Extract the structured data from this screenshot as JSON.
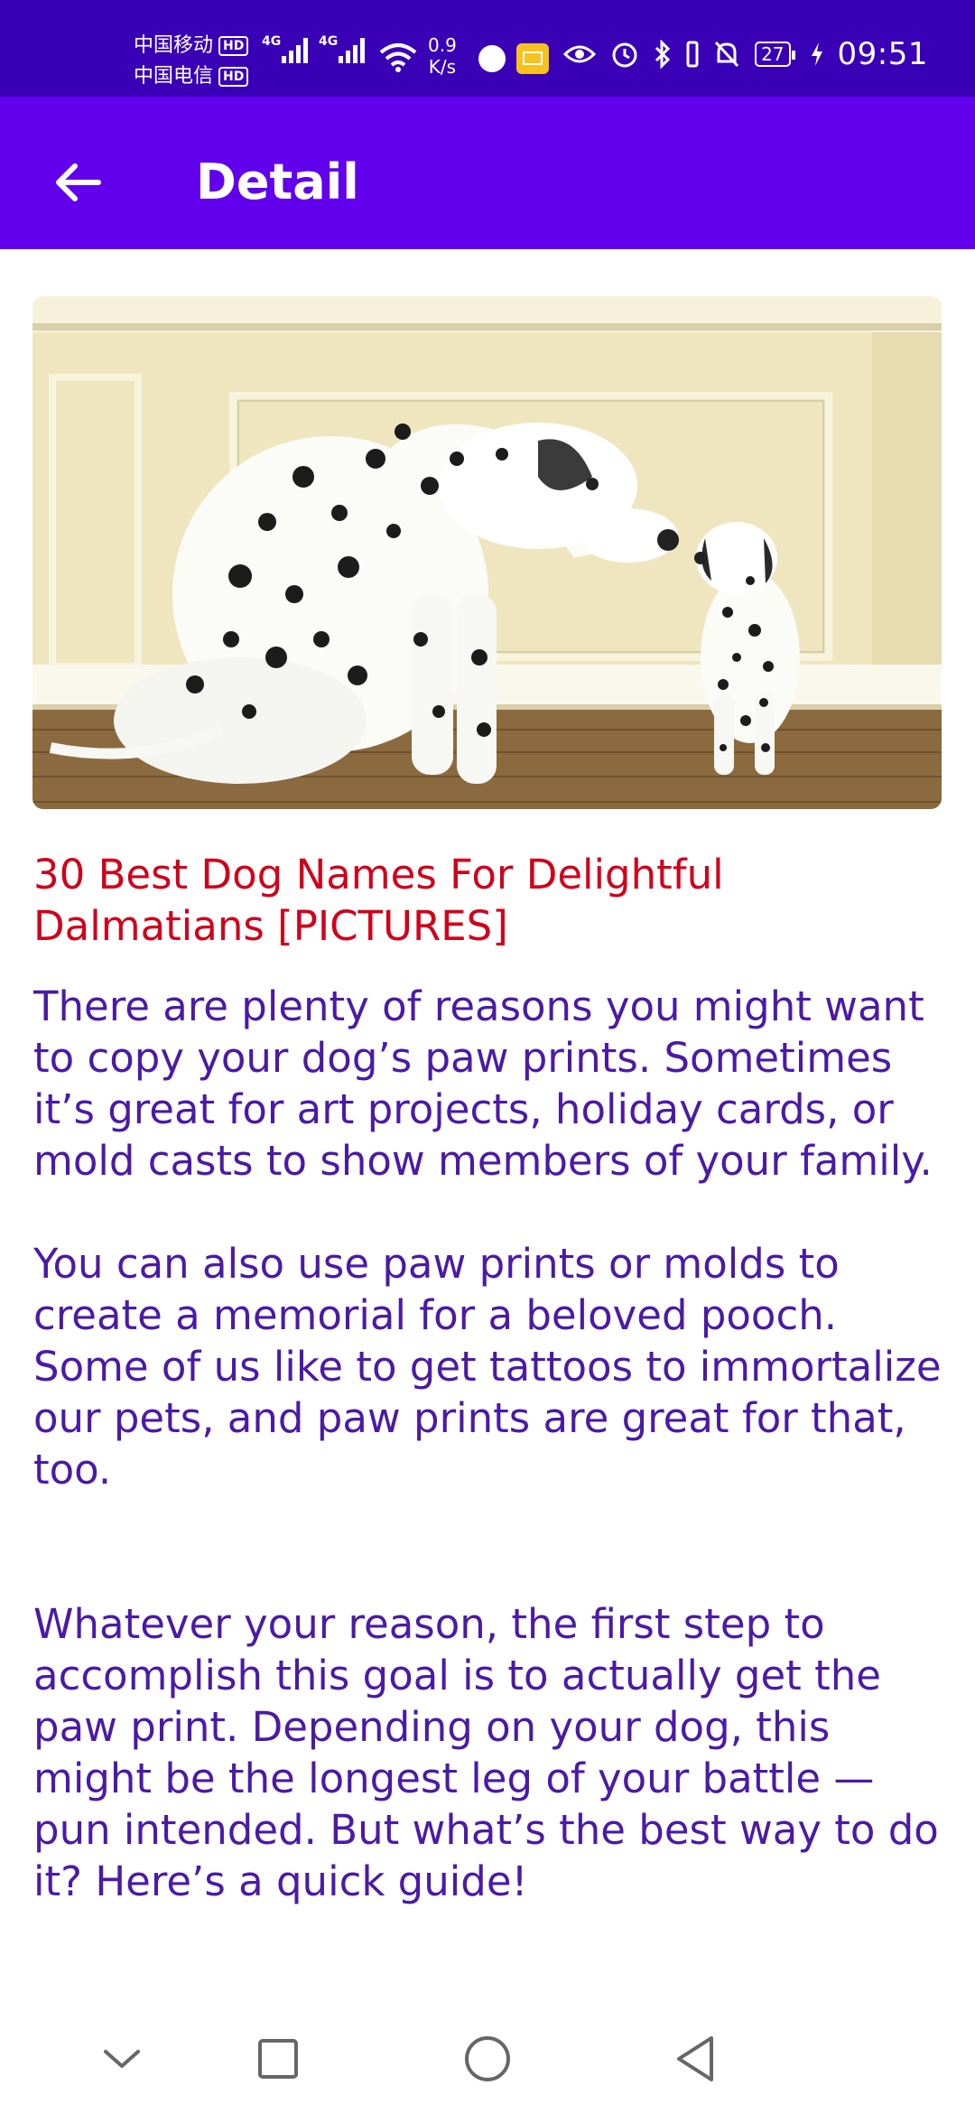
{
  "status_bar": {
    "carrier_1": "中国移动",
    "carrier_2": "中国电信",
    "hd_label": "HD",
    "network_type": "4G",
    "net_speed_value": "0.9",
    "net_speed_unit": "K/s",
    "battery_level": "27",
    "time": "09:51"
  },
  "app_bar": {
    "title": "Detail",
    "background_color": "#6200ee"
  },
  "article": {
    "title": "30 Best Dog Names For Delightful Dalmatians [PICTURES]",
    "paragraphs": [
      "There are plenty of reasons you might want to copy your dog’s paw prints. Sometimes it’s great for art projects, holiday cards, or mold casts to show members of your family.",
      "You can also use paw prints or molds to create a memorial for a beloved pooch. Some of us like to get tattoos to immortalize our pets, and paw prints are great for that, too.",
      "Whatever your reason, the first step to accomplish this goal is to actually get the paw print. Depending on your dog, this might be the longest leg of your battle — pun intended. But what’s the best way to do it? Here’s a quick guide!"
    ],
    "title_color": "#d0021b",
    "body_color": "#4b1aa6"
  },
  "icons": {
    "back": "back-arrow-icon",
    "nav_down": "chevron-down-icon",
    "nav_recents": "square-icon",
    "nav_home": "circle-icon",
    "nav_back": "triangle-back-icon"
  }
}
